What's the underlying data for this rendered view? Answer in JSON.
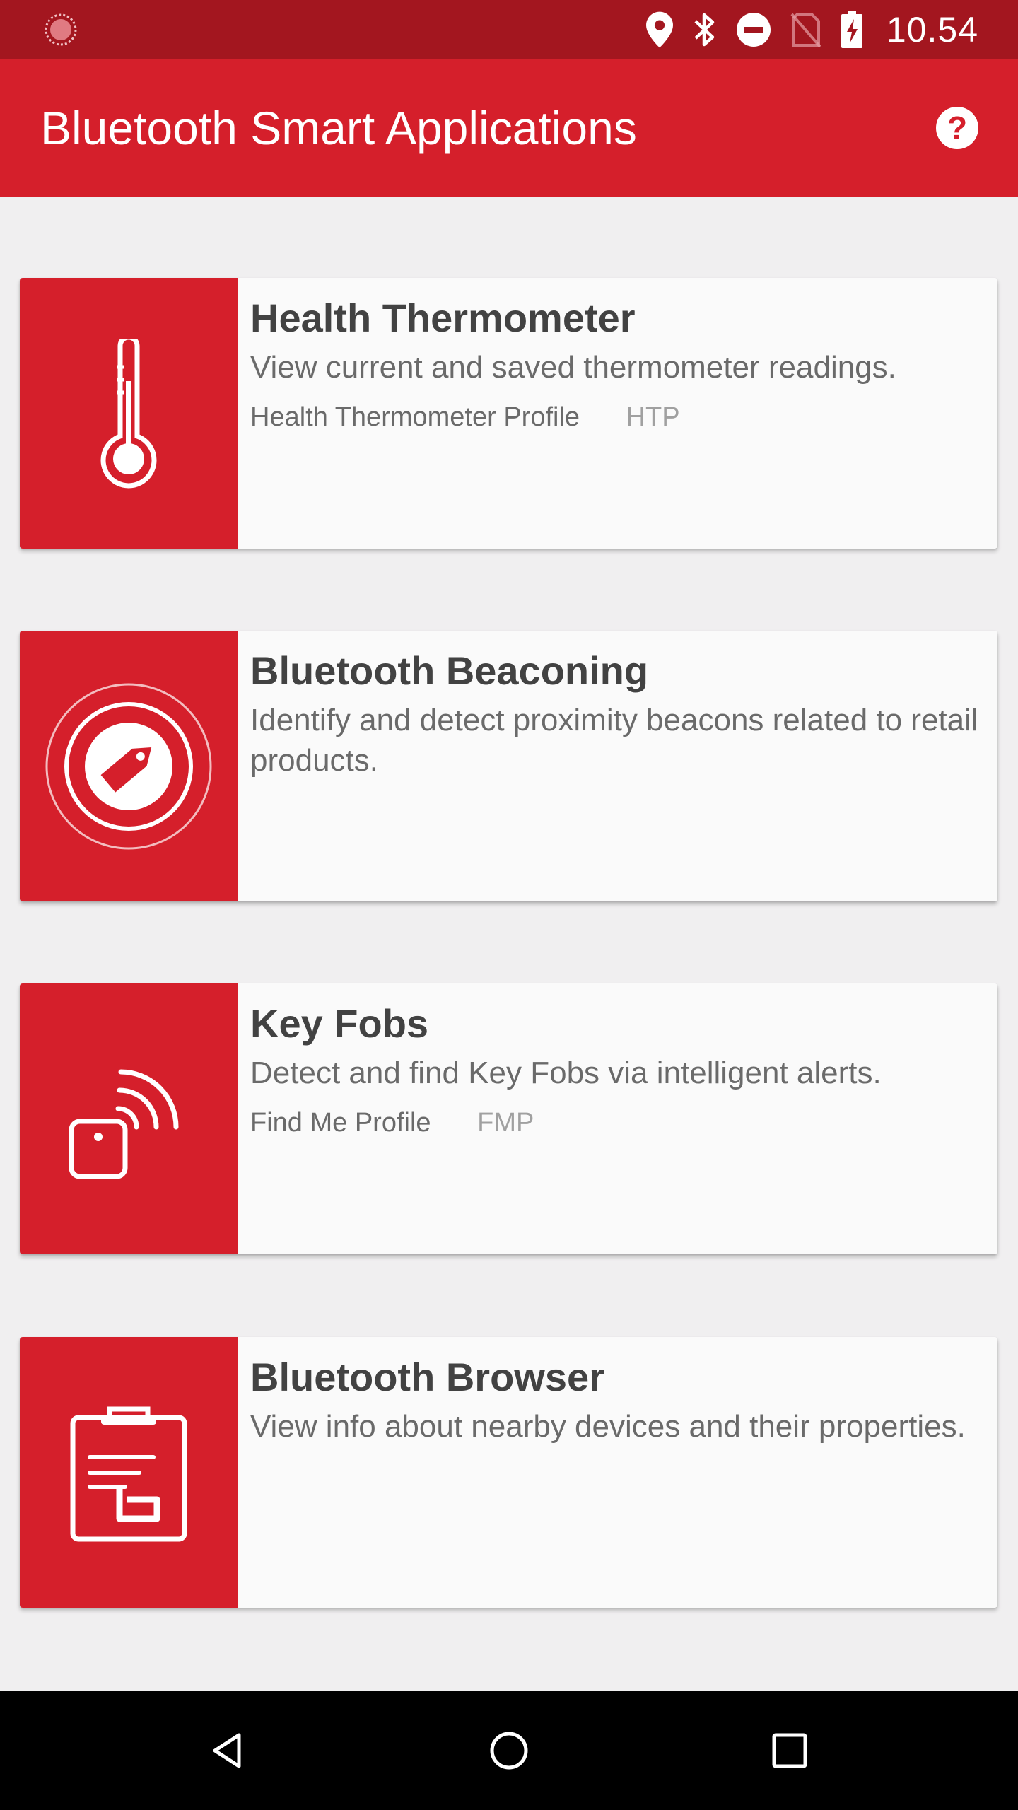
{
  "status_bar": {
    "time": "10.54",
    "icons": [
      "location-icon",
      "bluetooth-icon",
      "do-not-disturb-icon",
      "no-sim-icon",
      "battery-charging-icon"
    ]
  },
  "app_bar": {
    "title": "Bluetooth Smart Applications",
    "help_icon": "help-icon"
  },
  "cards": [
    {
      "title": "Health Thermometer",
      "description": "View current and saved thermometer readings.",
      "profile": "Health Thermometer Profile",
      "abbr": "HTP",
      "icon": "thermometer-icon"
    },
    {
      "title": "Bluetooth Beaconing",
      "description": "Identify and detect proximity beacons related to retail products.",
      "icon": "beacon-tag-icon"
    },
    {
      "title": "Key Fobs",
      "description": "Detect and find Key Fobs via intelligent alerts.",
      "profile": "Find Me Profile",
      "abbr": "FMP",
      "icon": "key-fob-icon"
    },
    {
      "title": "Bluetooth Browser",
      "description": "View info about nearby devices and their properties.",
      "icon": "clipboard-browser-icon"
    }
  ],
  "nav_bar": {
    "icons": [
      "back-icon",
      "home-icon",
      "recents-icon"
    ]
  },
  "colors": {
    "primary": "#d51f2b",
    "status_bar": "#a3161f",
    "background": "#f0eff0",
    "card": "#fafafa"
  }
}
